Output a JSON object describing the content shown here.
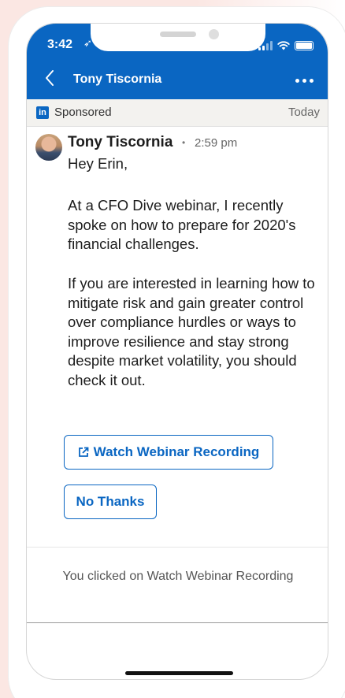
{
  "status_bar": {
    "time": "3:42",
    "location_icon": "location-arrow-icon"
  },
  "header": {
    "title": "Tony Tiscornia",
    "back_icon": "chevron-left-icon",
    "more_icon": "more-dots-icon"
  },
  "sponsored": {
    "logo_text": "in",
    "label": "Sponsored",
    "date": "Today"
  },
  "message": {
    "sender": "Tony Tiscornia",
    "separator": "•",
    "time": "2:59 pm",
    "greeting": "Hey Erin,",
    "paragraph1": "At a CFO Dive webinar, I recently spoke on how to prepare for 2020's financial challenges.",
    "paragraph2": "If you are interested in learning how to mitigate risk and gain greater control over compliance hurdles or ways to improve resilience and stay strong despite market volatility, you should check it out."
  },
  "actions": {
    "watch_label": "Watch Webinar Recording",
    "watch_icon": "external-link-icon",
    "no_thanks_label": "No Thanks"
  },
  "footer": {
    "clicked_note": "You clicked on Watch Webinar Recording"
  },
  "colors": {
    "brand_blue": "#0a66c2",
    "background_pink": "#fbe7e3"
  }
}
